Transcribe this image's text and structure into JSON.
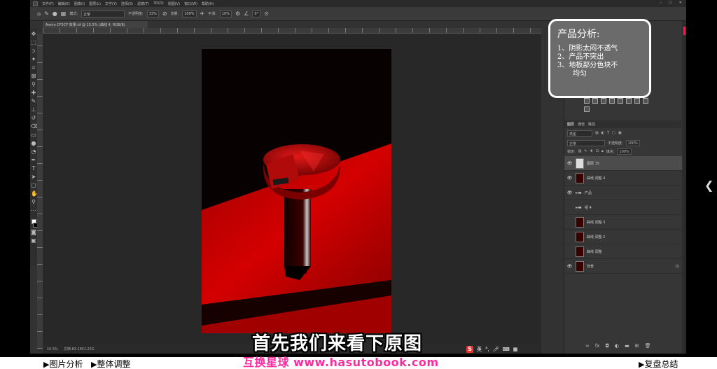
{
  "menubar": {
    "items": [
      "文件(F)",
      "编辑(E)",
      "图像(I)",
      "图层(L)",
      "文字(Y)",
      "选择(S)",
      "滤镜(T)",
      "3D(D)",
      "视图(V)",
      "窗口(W)",
      "帮助(H)"
    ]
  },
  "options": {
    "mode_label": "模式:",
    "mode_value": "正常",
    "opacity_label": "不透明度:",
    "opacity_value": "33%",
    "flow_label": "流量:",
    "flow_value": "100%",
    "smooth_label": "平滑:",
    "smooth_value": "10%",
    "angle_value": "0°"
  },
  "document": {
    "tab": "Amiro CF5CF 效果.tif @ 15.5% (曲线 4, RGB/8)"
  },
  "status": {
    "zoom": "15.5%",
    "doc_info": "文档:83.1M/1.25G"
  },
  "panel": {
    "tabs": [
      "图层",
      "通道",
      "路径"
    ],
    "kind_label": "类型",
    "blend_mode": "正常",
    "opacity_label": "不透明度:",
    "opacity_value": "100%",
    "lock_label": "锁定:",
    "fill_label": "填充:",
    "fill_value": "100%"
  },
  "layers": [
    {
      "name": "图层 15",
      "thumb": "white",
      "visible": true,
      "selected": true,
      "group": false
    },
    {
      "name": "曲线 调整 4",
      "thumb": "red",
      "visible": true,
      "selected": false,
      "group": false
    },
    {
      "name": "产品",
      "thumb": "none",
      "visible": true,
      "selected": false,
      "group": true
    },
    {
      "name": "组 4",
      "thumb": "none",
      "visible": false,
      "selected": false,
      "group": true
    },
    {
      "name": "曲线 调整 3",
      "thumb": "red",
      "visible": false,
      "selected": false,
      "group": false
    },
    {
      "name": "曲线 调整 2",
      "thumb": "red",
      "visible": false,
      "selected": false,
      "group": false
    },
    {
      "name": "曲线 调整",
      "thumb": "red",
      "visible": false,
      "selected": false,
      "group": false
    },
    {
      "name": "背景",
      "thumb": "red",
      "visible": true,
      "selected": false,
      "group": false,
      "locked": true
    }
  ],
  "note": {
    "title": "产品分析:",
    "items": [
      "1、阴影太闷不透气",
      "2、产品不突出",
      "3、地板部分色块不",
      "均匀"
    ]
  },
  "subtitle": "首先我们来看下原图",
  "watermark": "互换星球 www.hasutobook.com",
  "chapters": {
    "left": "图片分析",
    "middle": "整体调整",
    "right": "复盘总结"
  },
  "ime": {
    "logo": "S",
    "lang": "英"
  },
  "colors": {
    "accent_red": "#c80000",
    "watermark_pink": "#ff2aa0"
  }
}
